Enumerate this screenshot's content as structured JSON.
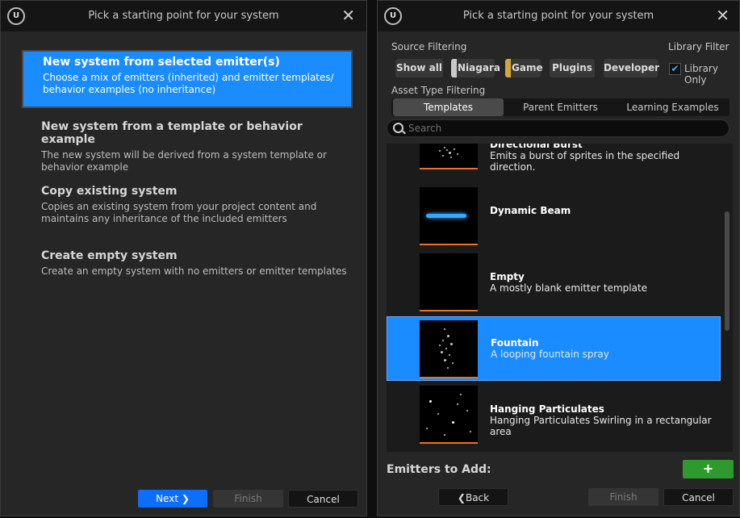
{
  "left_window": {
    "title": "Pick a starting point for your system",
    "logo_text": "U",
    "close_label": "✕",
    "options": [
      {
        "title": "New system from selected emitter(s)",
        "desc_line1": "Choose a mix of emitters (inherited) and emitter templates/",
        "desc_line2": "behavior examples (no inheritance)"
      },
      {
        "title": "New system from a template or behavior example",
        "desc_line1": "The new system will be derived from a system template or",
        "desc_line2": "behavior example"
      },
      {
        "title": "Copy existing system",
        "desc_line1": "Copies an existing system from your project content and",
        "desc_line2": "maintains any inheritance of the included emitters"
      },
      {
        "title": "Create empty system",
        "desc_line1": "Create an empty system with no emitters or emitter templates",
        "desc_line2": ""
      }
    ],
    "buttons": {
      "next": "Next ❯",
      "finish": "Finish",
      "cancel": "Cancel"
    }
  },
  "right_window": {
    "title": "Pick a starting point for your system",
    "logo_text": "U",
    "close_label": "✕",
    "source_filtering_label": "Source Filtering",
    "library_filter_label": "Library Filter",
    "source_chips": [
      {
        "label": "Show all",
        "color": ""
      },
      {
        "label": "Niagara",
        "color": "#c9c9c9"
      },
      {
        "label": "Game",
        "color": "#d4a53a"
      },
      {
        "label": "Plugins",
        "color": ""
      },
      {
        "label": "Developer",
        "color": ""
      }
    ],
    "library_only_label": "Library Only",
    "library_only_checked": true,
    "asset_type_label": "Asset Type Filtering",
    "asset_tabs": [
      "Templates",
      "Parent Emitters",
      "Learning Examples"
    ],
    "search_placeholder": "Search",
    "assets": [
      {
        "name": "Directional Burst",
        "desc": "Emits a burst of sprites in the specified direction."
      },
      {
        "name": "Dynamic Beam",
        "desc": ""
      },
      {
        "name": "Empty",
        "desc": "A mostly blank emitter template"
      },
      {
        "name": "Fountain",
        "desc": "A looping fountain spray"
      },
      {
        "name": "Hanging Particulates",
        "desc": "Hanging Particulates Swirling in a rectangular area"
      }
    ],
    "emitters_to_add_label": "Emitters to Add:",
    "add_button": "+",
    "buttons": {
      "back": "❮Back",
      "finish": "Finish",
      "cancel": "Cancel"
    }
  },
  "colors": {
    "accent": "#1a8cff",
    "next_button": "#0d6efd",
    "add_button": "#2e9a2e",
    "thumb_bar": "#e8742a"
  }
}
